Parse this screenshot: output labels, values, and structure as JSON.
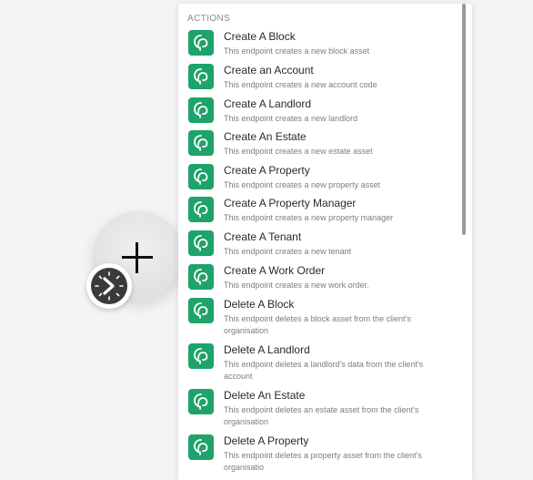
{
  "section_title": "ACTIONS",
  "items": [
    {
      "title": "Create A Block",
      "description": "This endpoint creates a new block asset"
    },
    {
      "title": "Create an Account",
      "description": "This endpoint creates a new account code"
    },
    {
      "title": "Create A Landlord",
      "description": "This endpoint creates a new landlord"
    },
    {
      "title": "Create An Estate",
      "description": "This endpoint creates a new estate asset"
    },
    {
      "title": "Create A Property",
      "description": "This endpoint creates a new property asset"
    },
    {
      "title": "Create A Property Manager",
      "description": "This endpoint creates a new property manager"
    },
    {
      "title": "Create A Tenant",
      "description": "This endpoint creates a new tenant"
    },
    {
      "title": "Create A Work Order",
      "description": "This endpoint creates a new work order."
    },
    {
      "title": "Delete A Block",
      "description": "This endpoint deletes a block asset from the client's organisation"
    },
    {
      "title": "Delete A Landlord",
      "description": "This endpoint deletes a landlord's data from the client's account"
    },
    {
      "title": "Delete An Estate",
      "description": "This endpoint deletes an estate asset from the client's organisation"
    },
    {
      "title": "Delete A Property",
      "description": "This endpoint deletes a property asset from the client's organisatio"
    }
  ],
  "icons": {
    "app": "app-logo-icon",
    "add": "plus-icon",
    "trigger": "clock-icon"
  },
  "colors": {
    "app_icon_bg": "#1ea36b",
    "background": "#f4f4f4"
  }
}
